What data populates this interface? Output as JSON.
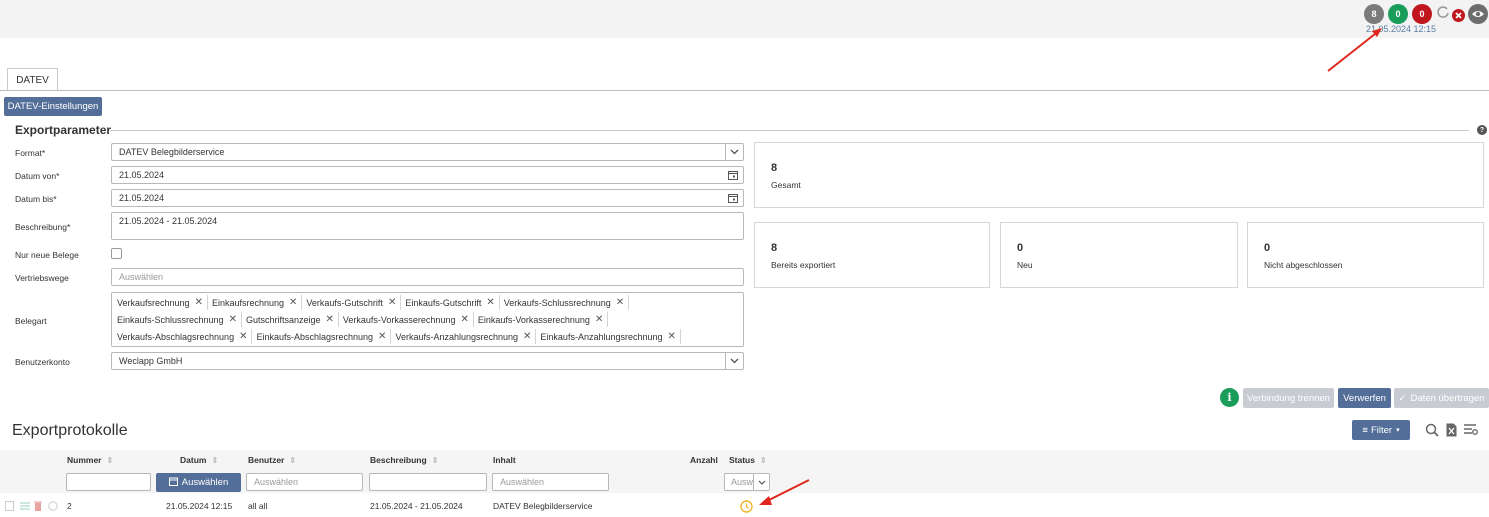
{
  "topbar": {
    "badges": [
      {
        "value": "8",
        "color": "#7b7b7b"
      },
      {
        "value": "0",
        "color": "#1a9c5b"
      },
      {
        "value": "0",
        "color": "#c0161d"
      }
    ],
    "timestamp": "21.05.2024 12:15",
    "icons": [
      "refresh-icon",
      "error-icon",
      "eye-icon"
    ]
  },
  "tabs": [
    {
      "label": "DATEV"
    }
  ],
  "settings_button": "DATEV-Einstellungen",
  "exportparameter": {
    "title": "Exportparameter",
    "fields": {
      "format": {
        "label": "Format*",
        "value": "DATEV Belegbilderservice"
      },
      "datum_von": {
        "label": "Datum von*",
        "value": "21.05.2024"
      },
      "datum_bis": {
        "label": "Datum bis*",
        "value": "21.05.2024"
      },
      "beschreibung": {
        "label": "Beschreibung*",
        "value": "21.05.2024 - 21.05.2024"
      },
      "nur_neue": {
        "label": "Nur neue Belege",
        "checked": false
      },
      "vertriebswege": {
        "label": "Vertriebswege",
        "placeholder": "Auswählen"
      },
      "belegart": {
        "label": "Belegart",
        "chips_row1": [
          "Verkaufsrechnung",
          "Einkaufsrechnung",
          "Verkaufs-Gutschrift",
          "Einkaufs-Gutschrift",
          "Verkaufs-Schlussrechnung"
        ],
        "chips_row2": [
          "Einkaufs-Schlussrechnung",
          "Gutschriftsanzeige",
          "Verkaufs-Vorkasserechnung",
          "Einkaufs-Vorkasserechnung"
        ],
        "chips_row3": [
          "Verkaufs-Abschlagsrechnung",
          "Einkaufs-Abschlagsrechnung",
          "Verkaufs-Anzahlungsrechnung",
          "Einkaufs-Anzahlungsrechnung"
        ]
      },
      "benutzerkonto": {
        "label": "Benutzerkonto",
        "value": "Weclapp GmbH"
      }
    }
  },
  "stats": {
    "gesamt": {
      "value": "8",
      "label": "Gesamt"
    },
    "bereits": {
      "value": "8",
      "label": "Bereits exportiert"
    },
    "neu": {
      "value": "0",
      "label": "Neu"
    },
    "nicht": {
      "value": "0",
      "label": "Nicht abgeschlossen"
    }
  },
  "actions": {
    "verbindung": "Verbindung trennen",
    "verwerfen": "Verwerfen",
    "daten": "Daten übertragen"
  },
  "protokolle": {
    "title": "Exportprotokolle",
    "filter_button": "Filter",
    "columns": [
      "Nummer",
      "Datum",
      "Benutzer",
      "Beschreibung",
      "Inhalt",
      "Anzahl",
      "Status"
    ],
    "filters": {
      "datum_button": "Auswählen",
      "benutzer": "Auswählen",
      "inhalt": "Auswählen",
      "status": "Ausw"
    },
    "rows": [
      {
        "nummer": "2",
        "datum": "21.05.2024 12:15",
        "benutzer": "all all",
        "beschreibung": "21.05.2024 - 21.05.2024",
        "inhalt": "DATEV Belegbilderservice",
        "anzahl": "",
        "status": "pending"
      }
    ]
  },
  "colors": {
    "accent": "#536e98",
    "arrow": "#e0261d",
    "info": "#1a9c5b",
    "status_pending": "#f0b429"
  }
}
